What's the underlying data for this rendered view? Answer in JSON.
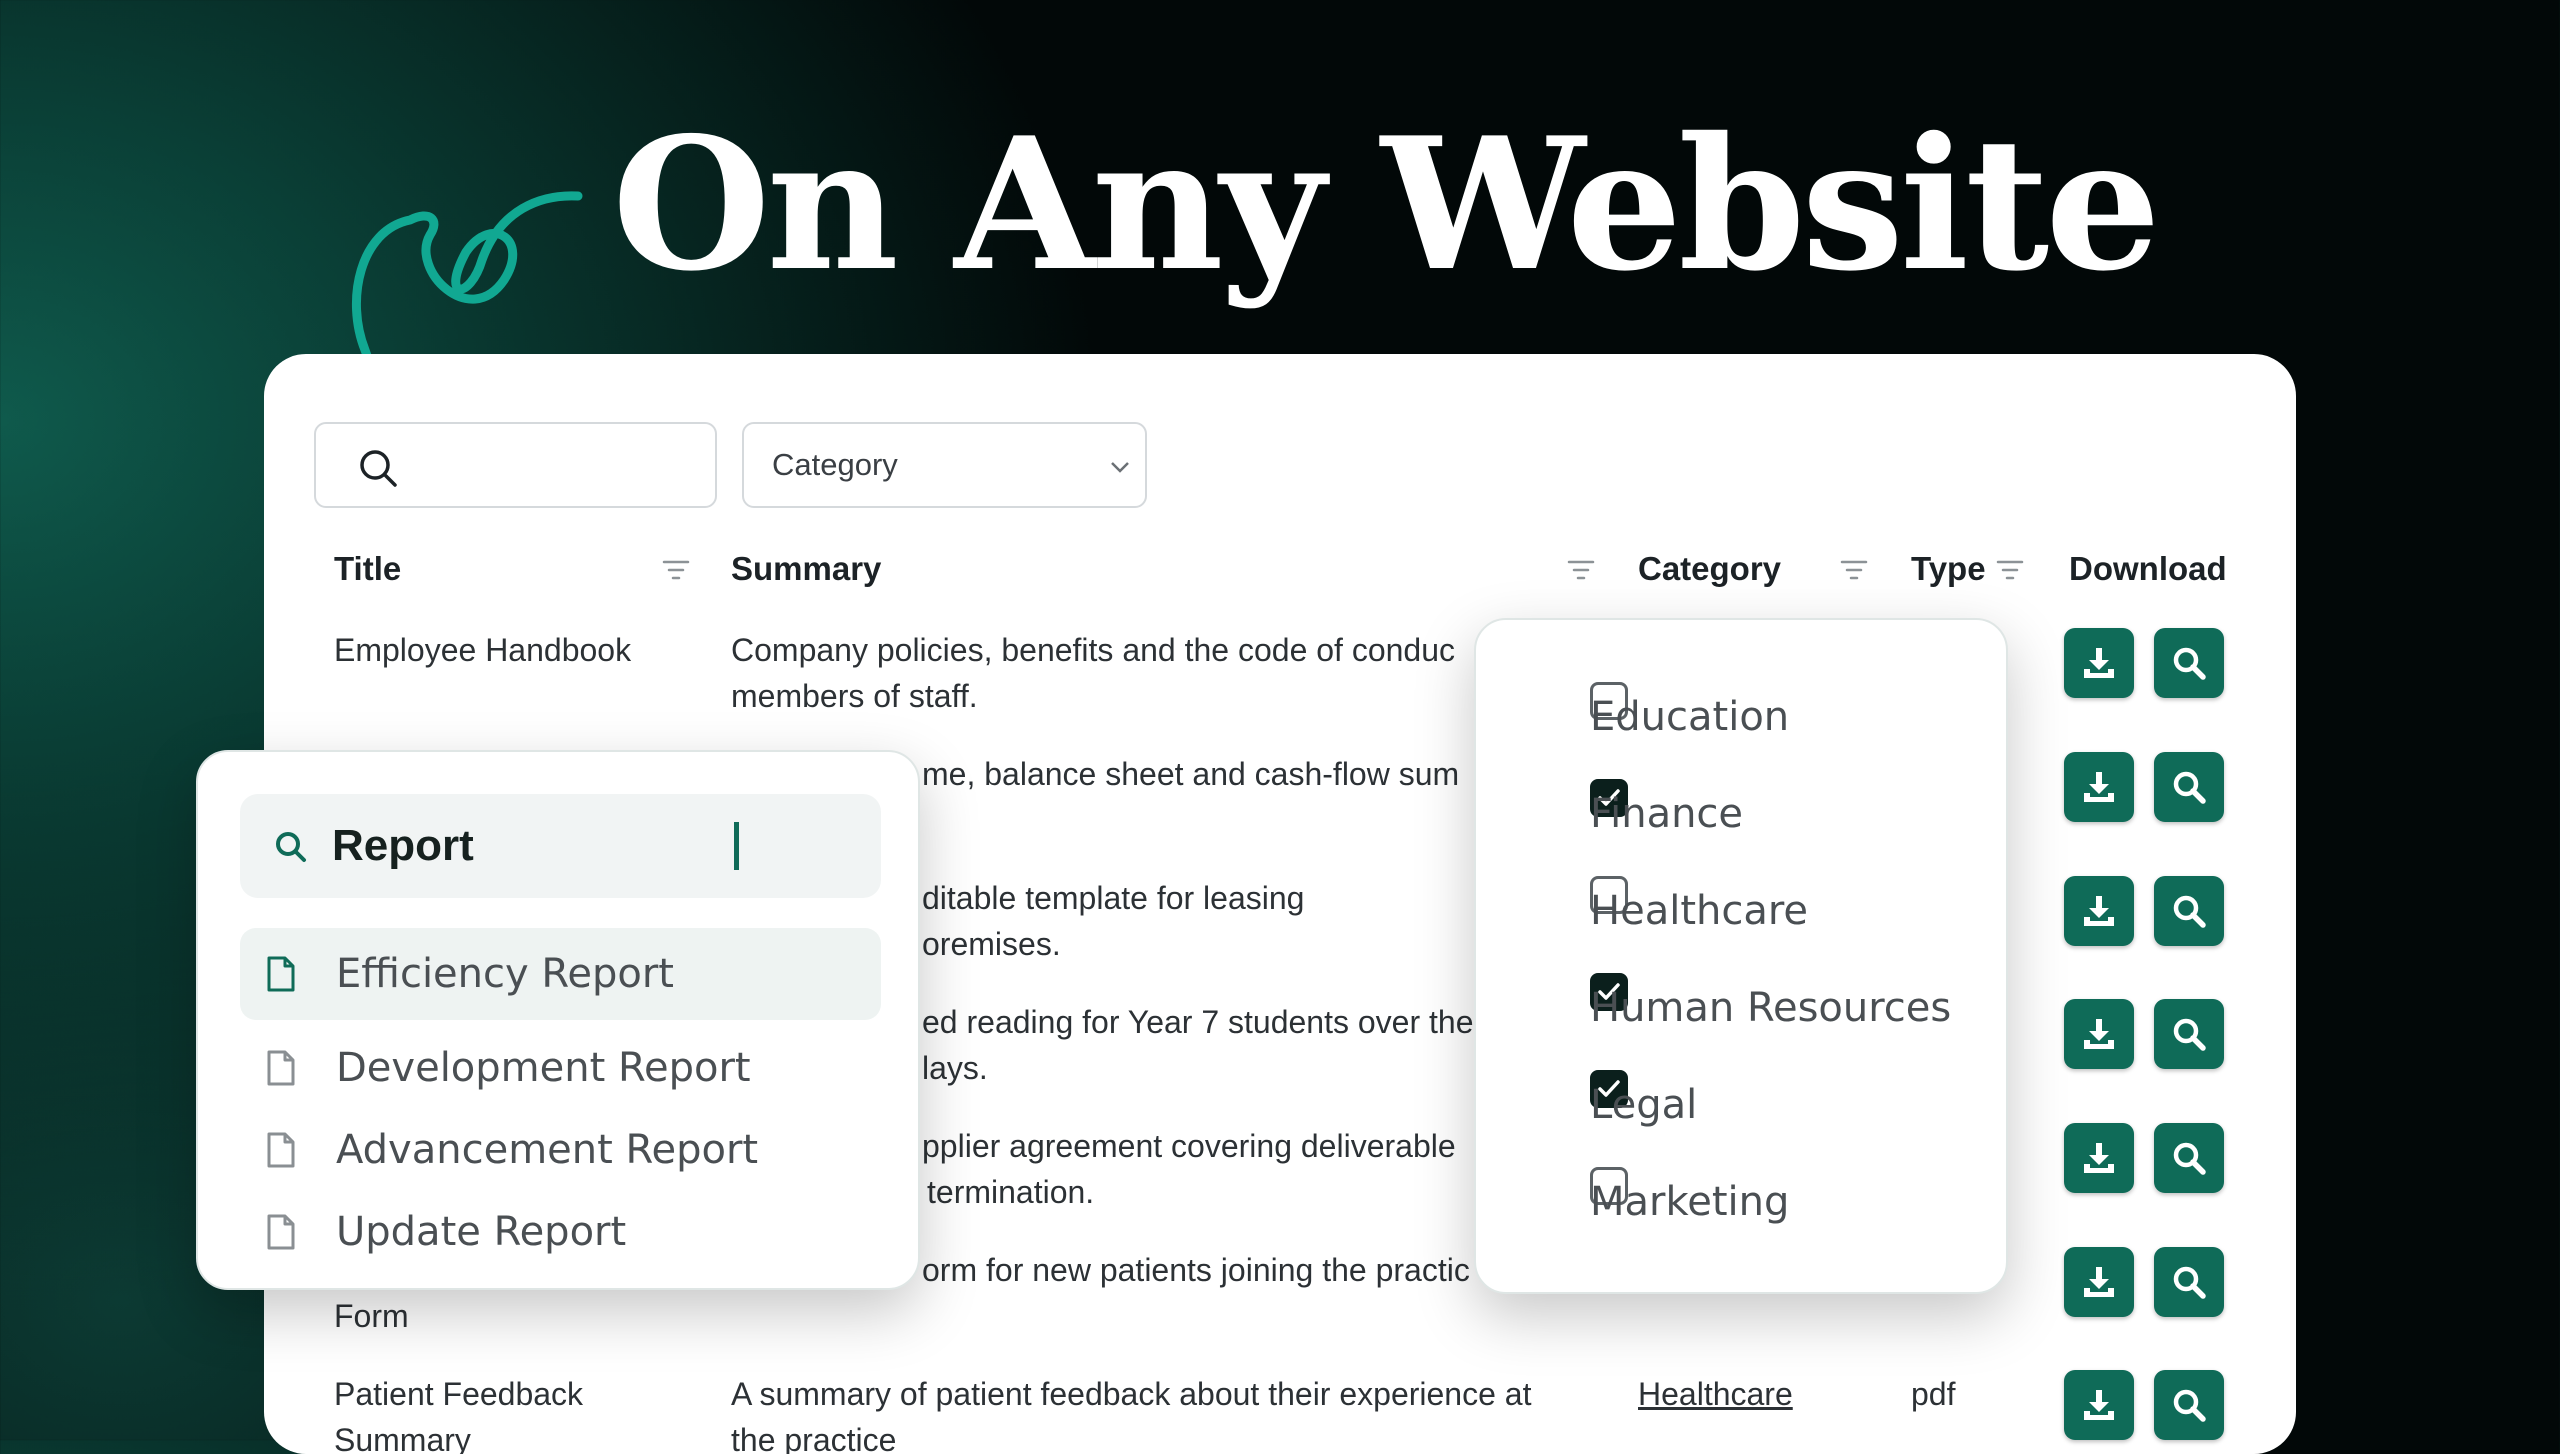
{
  "headline": "On Any Website",
  "toolbar": {
    "search_value": "",
    "category_select": "Category"
  },
  "table": {
    "headers": {
      "title": "Title",
      "summary": "Summary",
      "category": "Category",
      "type": "Type",
      "download": "Download"
    },
    "rows": [
      {
        "title_line1": "Employee Handbook",
        "title_line2": "",
        "summary_line1": "Company policies, benefits and the code of conduc",
        "summary_line2": "members of staff.",
        "category": "",
        "type": ""
      },
      {
        "title_line1": "",
        "title_line2": "",
        "summary_line1": "me, balance sheet and cash-flow sum",
        "summary_line2": "",
        "category": "",
        "type": ""
      },
      {
        "title_line1": "",
        "title_line2": "",
        "summary_line1": "ditable template for leasing",
        "summary_line2": "oremises.",
        "category": "",
        "type": ""
      },
      {
        "title_line1": "",
        "title_line2": "",
        "summary_line1": "ed reading for Year 7 students over the",
        "summary_line2": "lays.",
        "category": "",
        "type": ""
      },
      {
        "title_line1": "",
        "title_line2": "",
        "summary_line1": "pplier agreement covering deliverable",
        "summary_line2": "termination.",
        "category": "",
        "type": ""
      },
      {
        "title_line1": "",
        "title_line2": "Form",
        "summary_line1": "orm for new patients joining the practic",
        "summary_line2": "",
        "category": "",
        "type": ""
      },
      {
        "title_line1": "Patient Feedback",
        "title_line2": "Summary",
        "summary_line1": "A summary of patient feedback about their experience at",
        "summary_line2": "the practice",
        "category": "Healthcare",
        "type": "pdf"
      }
    ]
  },
  "autocomplete": {
    "query": "Report",
    "items": [
      {
        "label": "Efficiency Report",
        "active": true
      },
      {
        "label": "Development Report",
        "active": false
      },
      {
        "label": "Advancement Report",
        "active": false
      },
      {
        "label": "Update Report",
        "active": false
      }
    ]
  },
  "category_filter": {
    "options": [
      {
        "label": "Education",
        "checked": false
      },
      {
        "label": "Finance",
        "checked": true
      },
      {
        "label": "Healthcare",
        "checked": false
      },
      {
        "label": "Human Resources",
        "checked": true
      },
      {
        "label": "Legal",
        "checked": true
      },
      {
        "label": "Marketing",
        "checked": false
      }
    ]
  },
  "colors": {
    "accent": "#0f6b58",
    "arrow": "#11a892",
    "checkbox_checked": "#0b1f1c"
  },
  "icons": {
    "download": "download-icon",
    "search": "magnifier-icon",
    "filter": "filter-lines-icon",
    "document": "document-icon"
  }
}
